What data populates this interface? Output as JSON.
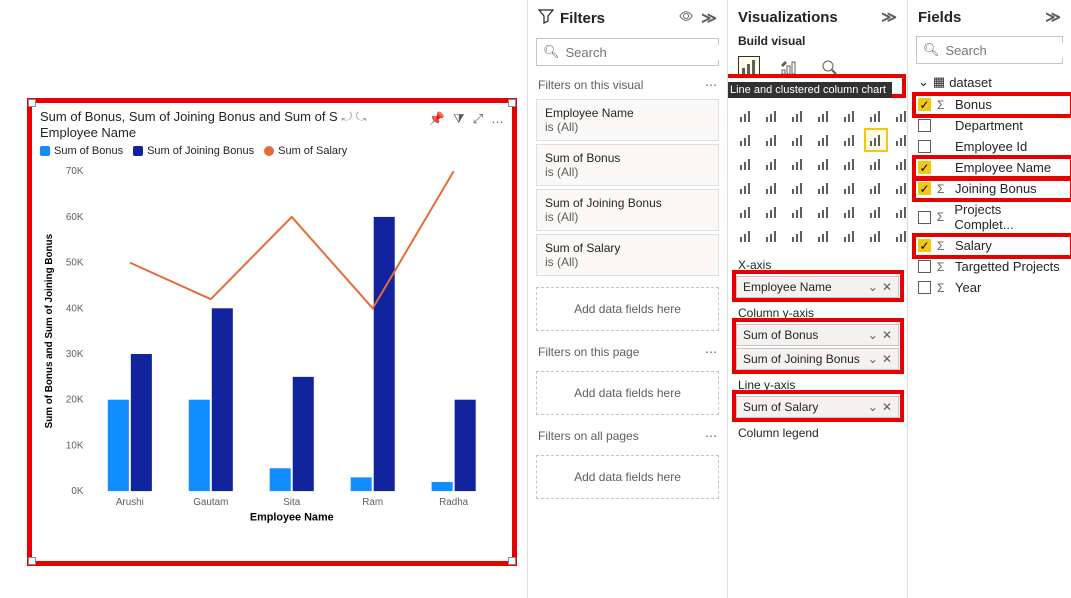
{
  "chart_data": {
    "type": "bar+line",
    "categories": [
      "Arushi",
      "Gautam",
      "Sita",
      "Ram",
      "Radha"
    ],
    "series": [
      {
        "name": "Sum of Bonus",
        "type": "bar",
        "color": "#118dff",
        "values": [
          20000,
          20000,
          5000,
          3000,
          2000
        ]
      },
      {
        "name": "Sum of Joining Bonus",
        "type": "bar",
        "color": "#12239e",
        "values": [
          30000,
          40000,
          25000,
          60000,
          20000
        ]
      },
      {
        "name": "Sum of Salary",
        "type": "line",
        "color": "#e66c37",
        "values": [
          50000,
          42000,
          60000,
          40000,
          70000
        ]
      }
    ],
    "title_line1": "Sum of Bonus, Sum of Joining Bonus and Sum of S",
    "title_line2": "Employee Name",
    "xlabel": "Employee Name",
    "ylabel": "Sum of Bonus and Sum of Joining Bonus",
    "ylim": [
      0,
      70000
    ],
    "yticks": [
      0,
      10000,
      20000,
      30000,
      40000,
      50000,
      60000,
      70000
    ],
    "ytick_labels": [
      "0K",
      "10K",
      "20K",
      "30K",
      "40K",
      "50K",
      "60K",
      "70K"
    ]
  },
  "chart_actions": {
    "pin": "📌",
    "filter": "⧩",
    "focus": "⤢",
    "more": "…"
  },
  "filters": {
    "title": "Filters",
    "search_placeholder": "Search",
    "group1": "Filters on this visual",
    "cards": [
      {
        "name": "Employee Name",
        "val": "is (All)"
      },
      {
        "name": "Sum of Bonus",
        "val": "is (All)"
      },
      {
        "name": "Sum of Joining Bonus",
        "val": "is (All)"
      },
      {
        "name": "Sum of Salary",
        "val": "is (All)"
      }
    ],
    "add": "Add data fields here",
    "group2": "Filters on this page",
    "group3": "Filters on all pages"
  },
  "viz": {
    "title": "Visualizations",
    "sub": "Build visual",
    "tooltip": "Line and clustered column chart",
    "wells": {
      "xaxis": {
        "label": "X-axis",
        "items": [
          "Employee Name"
        ]
      },
      "colY": {
        "label": "Column y-axis",
        "items": [
          "Sum of Bonus",
          "Sum of Joining Bonus"
        ]
      },
      "lineY": {
        "label": "Line y-axis",
        "items": [
          "Sum of Salary"
        ]
      },
      "colLegend": {
        "label": "Column legend"
      }
    }
  },
  "fields": {
    "title": "Fields",
    "search_placeholder": "Search",
    "dataset": "dataset",
    "rows": [
      {
        "name": "Bonus",
        "sigma": true,
        "checked": true,
        "red": true
      },
      {
        "name": "Department",
        "sigma": false,
        "checked": false,
        "red": false
      },
      {
        "name": "Employee Id",
        "sigma": false,
        "checked": false,
        "red": false
      },
      {
        "name": "Employee Name",
        "sigma": false,
        "checked": true,
        "red": true
      },
      {
        "name": "Joining Bonus",
        "sigma": true,
        "checked": true,
        "red": true
      },
      {
        "name": "Projects Complet...",
        "sigma": true,
        "checked": false,
        "red": false
      },
      {
        "name": "Salary",
        "sigma": true,
        "checked": true,
        "red": true
      },
      {
        "name": "Targetted Projects",
        "sigma": true,
        "checked": false,
        "red": false
      },
      {
        "name": "Year",
        "sigma": true,
        "checked": false,
        "red": false
      }
    ]
  }
}
